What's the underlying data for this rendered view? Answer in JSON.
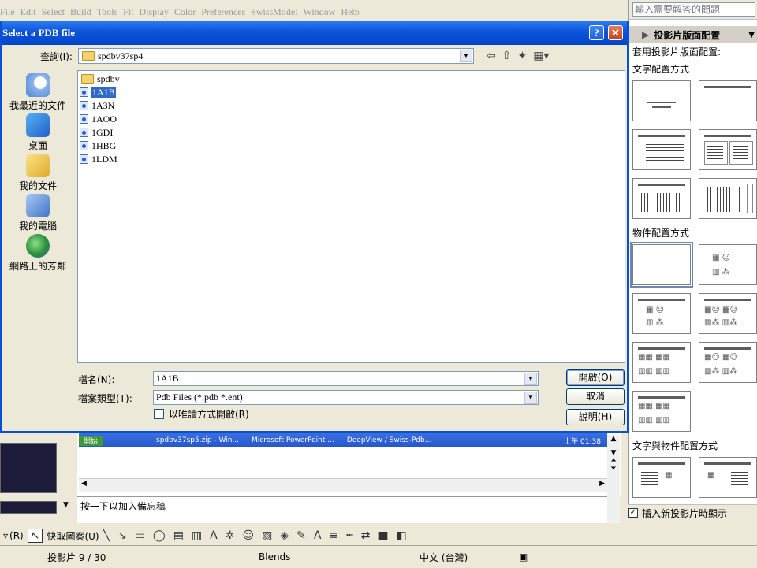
{
  "menubar": [
    "File",
    "Edit",
    "Select",
    "Build",
    "Tools",
    "Fit",
    "Display",
    "Color",
    "Preferences",
    "SwissModel",
    "Window",
    "Help"
  ],
  "taskpane": {
    "help_placeholder": "輸入需要解答的問題",
    "title": "投影片版面配置",
    "apply_label": "套用投影片版面配置:",
    "section_text": "文字配置方式",
    "section_object": "物件配置方式",
    "section_text_object": "文字與物件配置方式",
    "insert_show": "插入新投影片時顯示"
  },
  "dialog": {
    "title": "Select a PDB file",
    "lookin_label": "查詢(I):",
    "lookin_value": "spdbv37sp4",
    "places": [
      "我最近的文件",
      "桌面",
      "我的文件",
      "我的電腦",
      "網路上的芳鄰"
    ],
    "folder": "spdbv",
    "files": [
      "1A1B",
      "1A3N",
      "1AOO",
      "1GDI",
      "1HBG",
      "1LDM"
    ],
    "selected_file": "1A1B",
    "filename_label": "檔名(N):",
    "filename_value": "1A1B",
    "filetype_label": "檔案類型(T):",
    "filetype_value": "Pdb Files (*.pdb *.ent)",
    "readonly_label": "以唯讀方式開啟(R)",
    "open_button": "開啟(O)",
    "cancel_button": "取消",
    "help_button": "說明(H)"
  },
  "taskbar": {
    "items": [
      "開始",
      "spdbv37sp5.zip - Win...",
      "Microsoft PowerPoint ...",
      "DeepView / Swiss-Pdb..."
    ],
    "clock": "上午 01:38"
  },
  "notes_placeholder": "按一下以加入備忘稿",
  "drawbar": {
    "autoshapes": "快取圖案(U)",
    "draw_prefix": "(R)"
  },
  "status": {
    "slide": "投影片 9 / 30",
    "design": "Blends",
    "language": "中文 (台灣)"
  }
}
